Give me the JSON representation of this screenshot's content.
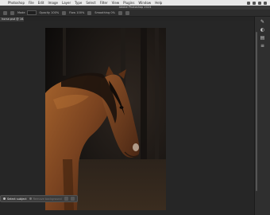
{
  "menubar": {
    "items": [
      "Photoshop",
      "File",
      "Edit",
      "Image",
      "Layer",
      "Type",
      "Select",
      "Filter",
      "View",
      "Plugins",
      "Window",
      "Help"
    ]
  },
  "window": {
    "title": "Adobe Photoshop 2024"
  },
  "options": {
    "mode_label": "Mode",
    "opacity_label": "Opacity",
    "opacity_value": "100%",
    "flow_label": "Flow",
    "flow_value": "100%",
    "smoothing_label": "Smoothing",
    "smoothing_value": "0%"
  },
  "document": {
    "tab_label": "horse.psd @ 16.7% (RGB/8#)"
  },
  "contextual_taskbar": {
    "select_subject": "Select subject",
    "remove_background": "Remove background"
  },
  "colors": {
    "menubar": "#e9e9e9",
    "canvas": "#262626",
    "panel": "#2f2f2f"
  }
}
